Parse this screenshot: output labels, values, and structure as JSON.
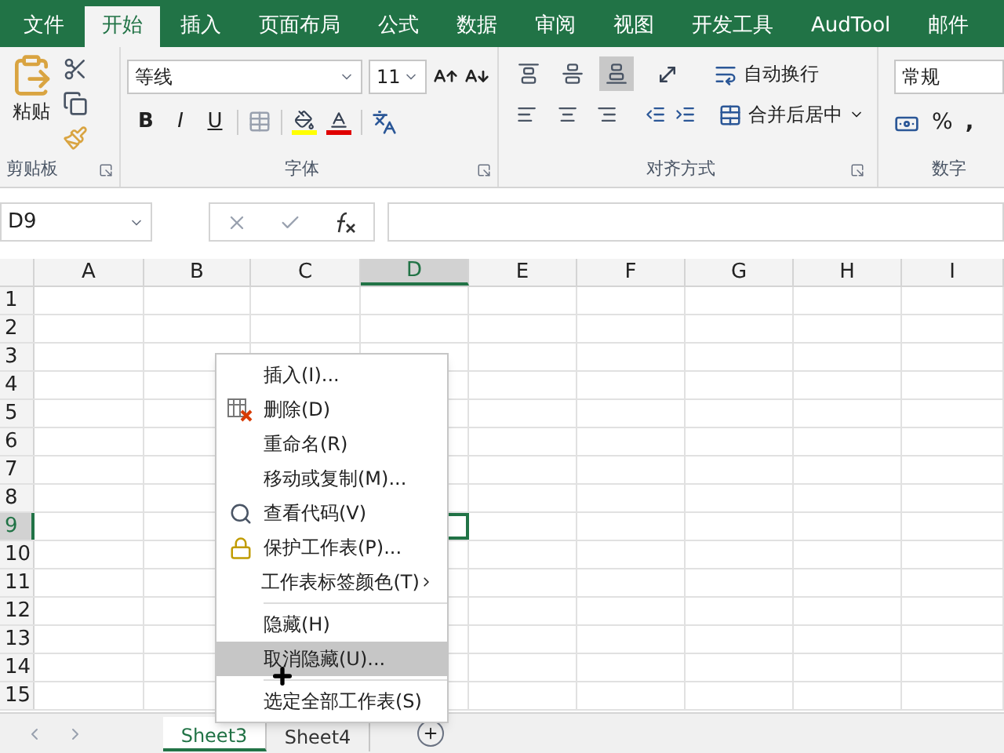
{
  "ribbon_tabs": [
    {
      "label": "文件",
      "selected": false
    },
    {
      "label": "开始",
      "selected": true
    },
    {
      "label": "插入",
      "selected": false
    },
    {
      "label": "页面布局",
      "selected": false
    },
    {
      "label": "公式",
      "selected": false
    },
    {
      "label": "数据",
      "selected": false
    },
    {
      "label": "审阅",
      "selected": false
    },
    {
      "label": "视图",
      "selected": false
    },
    {
      "label": "开发工具",
      "selected": false
    },
    {
      "label": "AudTool",
      "selected": false
    },
    {
      "label": "邮件",
      "selected": false
    }
  ],
  "clipboard": {
    "paste": "粘贴",
    "label": "剪贴板"
  },
  "font": {
    "name": "等线",
    "size": "11",
    "styles": [
      "B",
      "I",
      "U"
    ],
    "label": "字体"
  },
  "alignment": {
    "vertical": [
      {
        "selected": false
      },
      {
        "selected": false
      },
      {
        "selected": true
      }
    ],
    "wrap": "自动换行",
    "merge": "合并后居中",
    "label": "对齐方式"
  },
  "number": {
    "format": "常规",
    "percent": "%",
    "comma": ",",
    "label": "数字"
  },
  "name_box": "D9",
  "columns": [
    {
      "label": "A",
      "selected": false
    },
    {
      "label": "B",
      "selected": false
    },
    {
      "label": "C",
      "selected": false
    },
    {
      "label": "D",
      "selected": true
    },
    {
      "label": "E",
      "selected": false
    },
    {
      "label": "F",
      "selected": false
    },
    {
      "label": "G",
      "selected": false
    },
    {
      "label": "H",
      "selected": false
    },
    {
      "label": "I",
      "selected": false
    }
  ],
  "rows": [
    {
      "label": "1",
      "selected": false
    },
    {
      "label": "2",
      "selected": false
    },
    {
      "label": "3",
      "selected": false
    },
    {
      "label": "4",
      "selected": false
    },
    {
      "label": "5",
      "selected": false
    },
    {
      "label": "6",
      "selected": false
    },
    {
      "label": "7",
      "selected": false
    },
    {
      "label": "8",
      "selected": false
    },
    {
      "label": "9",
      "selected": true
    },
    {
      "label": "10",
      "selected": false
    },
    {
      "label": "11",
      "selected": false
    },
    {
      "label": "12",
      "selected": false
    },
    {
      "label": "13",
      "selected": false
    },
    {
      "label": "14",
      "selected": false
    },
    {
      "label": "15",
      "selected": false
    }
  ],
  "context_menu": [
    {
      "kind": "plain",
      "label": "插入(I)...",
      "selected": false
    },
    {
      "kind": "delete",
      "label": "删除(D)",
      "selected": false
    },
    {
      "kind": "plain",
      "label": "重命名(R)",
      "selected": false
    },
    {
      "kind": "plain",
      "label": "移动或复制(M)...",
      "selected": false
    },
    {
      "kind": "code",
      "label": "查看代码(V)",
      "selected": false
    },
    {
      "kind": "protect",
      "label": "保护工作表(P)...",
      "selected": false
    },
    {
      "kind": "submenu",
      "label": "工作表标签颜色(T)",
      "selected": false
    },
    {
      "kind": "separator"
    },
    {
      "kind": "plain",
      "label": "隐藏(H)",
      "selected": false
    },
    {
      "kind": "plain",
      "label": "取消隐藏(U)...",
      "selected": true
    },
    {
      "kind": "separator"
    },
    {
      "kind": "plain",
      "label": "选定全部工作表(S)",
      "selected": false
    }
  ],
  "sheet_tabs": [
    {
      "label": "Sheet3",
      "selected": true
    },
    {
      "label": "Sheet4",
      "selected": false
    }
  ]
}
